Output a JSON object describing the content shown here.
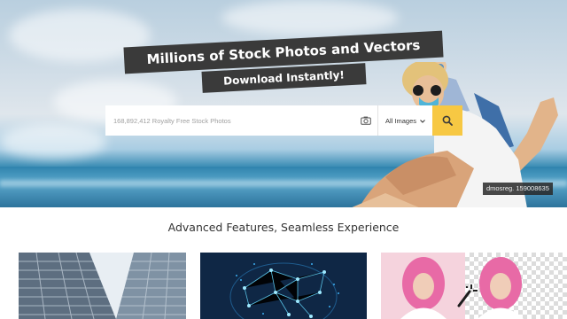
{
  "hero": {
    "headline": "Millions of Stock Photos and Vectors",
    "subheadline": "Download Instantly!",
    "credit": "dmosreg. 159008635"
  },
  "search": {
    "placeholder": "168,892,412 Royalty Free Stock Photos",
    "filter_value": "All Images",
    "icons": {
      "camera": "camera-icon",
      "chevron": "chevron-down-icon",
      "search": "search-icon"
    },
    "button_color": "#f7c843"
  },
  "features": {
    "title": "Advanced Features, Seamless Experience",
    "cards": [
      {
        "name": "architecture-photo"
      },
      {
        "name": "ai-network-graphic"
      },
      {
        "name": "background-remover-example"
      }
    ]
  }
}
